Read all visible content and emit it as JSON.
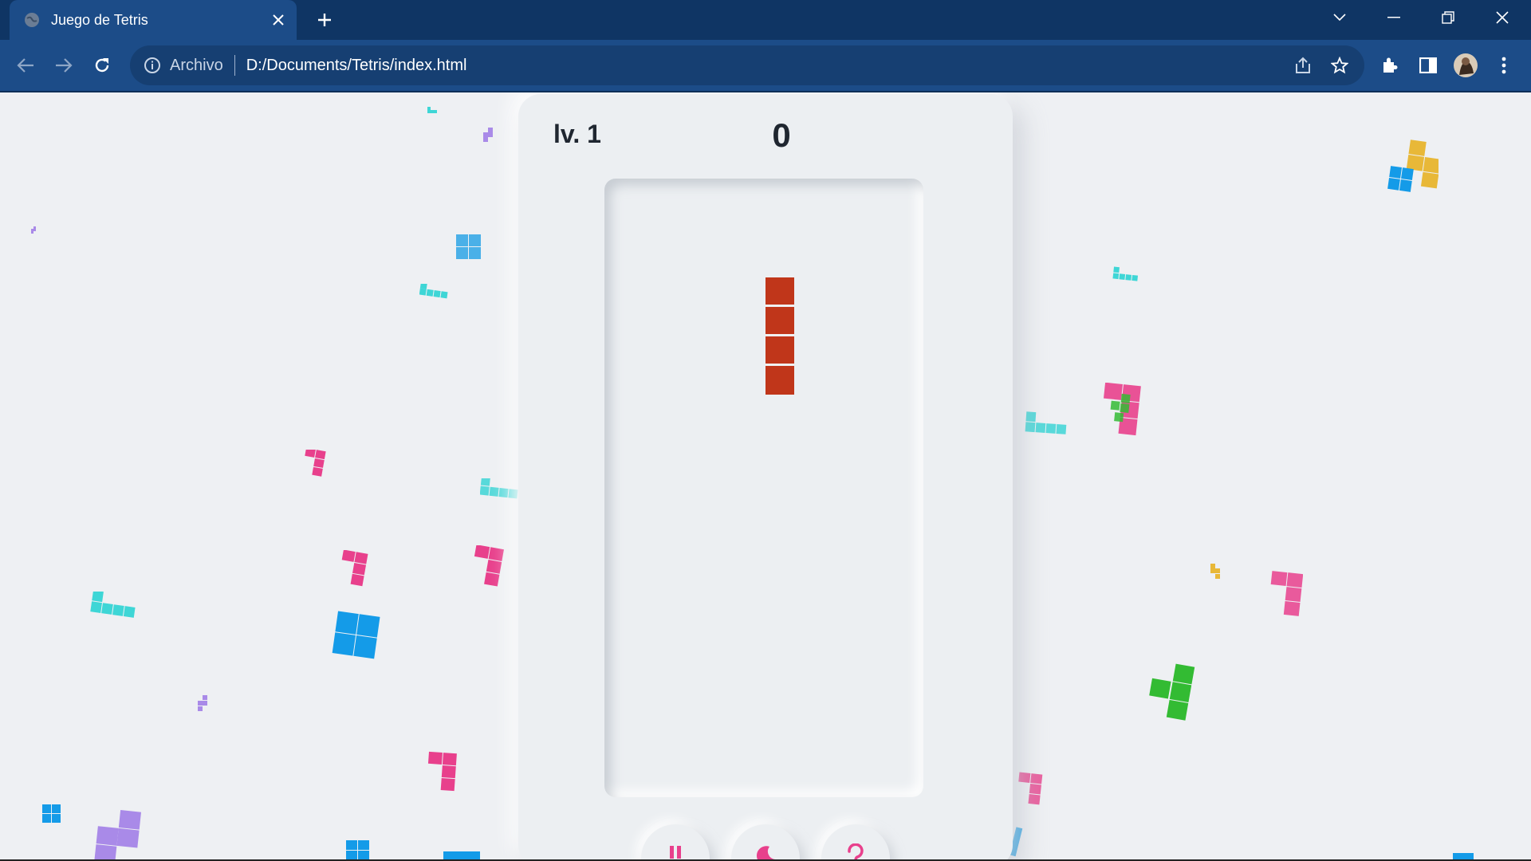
{
  "browser": {
    "tab_title": "Juego de Tetris",
    "address_scheme": "Archivo",
    "address_url": "D:/Documents/Tetris/index.html"
  },
  "game": {
    "level_label": "lv. 1",
    "score": "0",
    "current_piece_color": "#c0361a",
    "controls": [
      "pause-icon",
      "moon-icon",
      "help-icon"
    ]
  },
  "colors": {
    "page_bg": "#eef0f3",
    "cyan": "#3ed6d6",
    "blue": "#149be8",
    "pink": "#e8408c",
    "purple": "#a98ae8",
    "yellow": "#e8b838",
    "green": "#33bb33"
  }
}
